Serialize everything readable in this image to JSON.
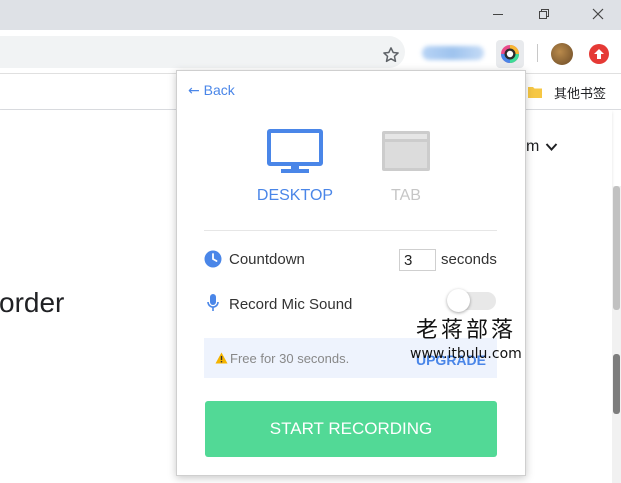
{
  "browser": {
    "bookmark_folder": "其他书签",
    "account_menu_partial": "m"
  },
  "page": {
    "headline_partial": "order"
  },
  "popup": {
    "back_label": "Back",
    "modes": [
      {
        "label": "DESKTOP",
        "active": true,
        "color": "#4a86e8"
      },
      {
        "label": "TAB",
        "active": false,
        "color": "#c6c6c6"
      }
    ],
    "countdown": {
      "label": "Countdown",
      "value": "3",
      "unit": "seconds"
    },
    "mic": {
      "label": "Record Mic Sound",
      "enabled": false
    },
    "notice": {
      "text": "Free for 30 seconds.",
      "action": "UPGRADE"
    },
    "start_label": "START RECORDING",
    "accent": "#4a86e8",
    "start_color": "#52d996"
  },
  "watermark": {
    "title": "老蒋部落",
    "url": "www.itbulu.com"
  }
}
